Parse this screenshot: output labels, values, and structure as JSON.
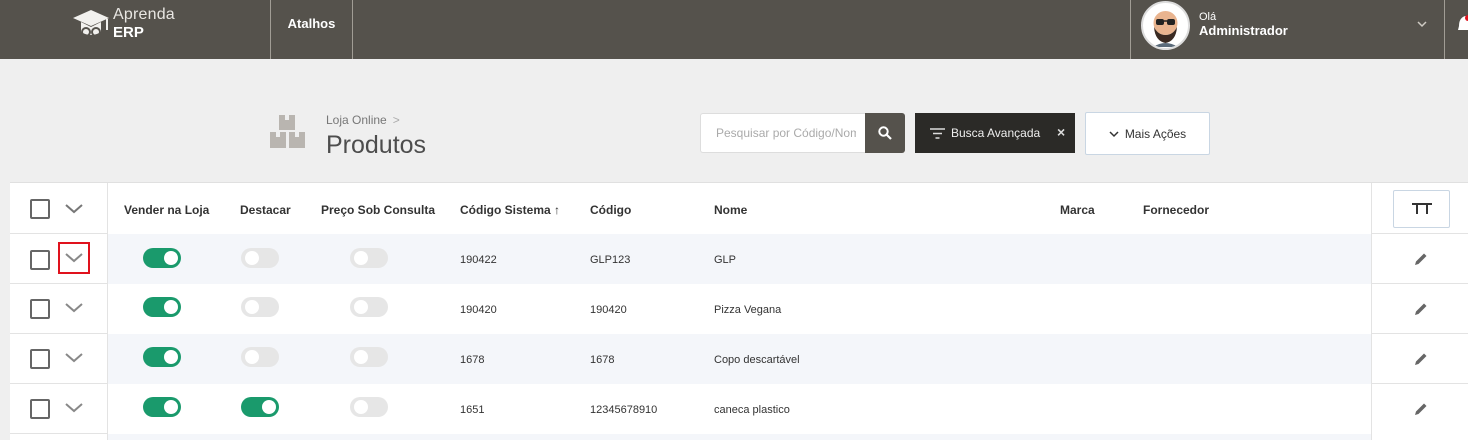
{
  "topbar": {
    "logo_line1": "Aprenda",
    "logo_line2": "ERP",
    "shortcuts_label": "Atalhos",
    "greeting": "Olá",
    "username": "Administrador"
  },
  "breadcrumb": {
    "parent": "Loja Online",
    "separator": ">"
  },
  "page_title": "Produtos",
  "search": {
    "placeholder": "Pesquisar por Código/Nome",
    "value": ""
  },
  "advanced_search_label": "Busca Avançada",
  "advanced_search_clear": "×",
  "more_actions_label": "Mais Ações",
  "table": {
    "columns": {
      "sell": "Vender na Loja",
      "highlight": "Destacar",
      "price_on_request": "Preço Sob Consulta",
      "system_code": "Código Sistema",
      "sort_indicator": "↑",
      "code": "Código",
      "name": "Nome",
      "brand": "Marca",
      "supplier": "Fornecedor"
    },
    "rows": [
      {
        "sell": true,
        "highlight": false,
        "price_on_request": false,
        "system_code": "190422",
        "code": "GLP123",
        "name": "GLP",
        "brand": "",
        "supplier": ""
      },
      {
        "sell": true,
        "highlight": false,
        "price_on_request": false,
        "system_code": "190420",
        "code": "190420",
        "name": "Pizza Vegana",
        "brand": "",
        "supplier": ""
      },
      {
        "sell": true,
        "highlight": false,
        "price_on_request": false,
        "system_code": "1678",
        "code": "1678",
        "name": "Copo descartável",
        "brand": "",
        "supplier": ""
      },
      {
        "sell": true,
        "highlight": true,
        "price_on_request": false,
        "system_code": "1651",
        "code": "12345678910",
        "name": "caneca plastico",
        "brand": "",
        "supplier": ""
      }
    ]
  },
  "colors": {
    "topbar": "#55524c",
    "toggle_on": "#1a9a6c",
    "toggle_off": "#e6e6e6",
    "highlight_outline": "#e0121d",
    "advanced_btn": "#2b2a27"
  }
}
